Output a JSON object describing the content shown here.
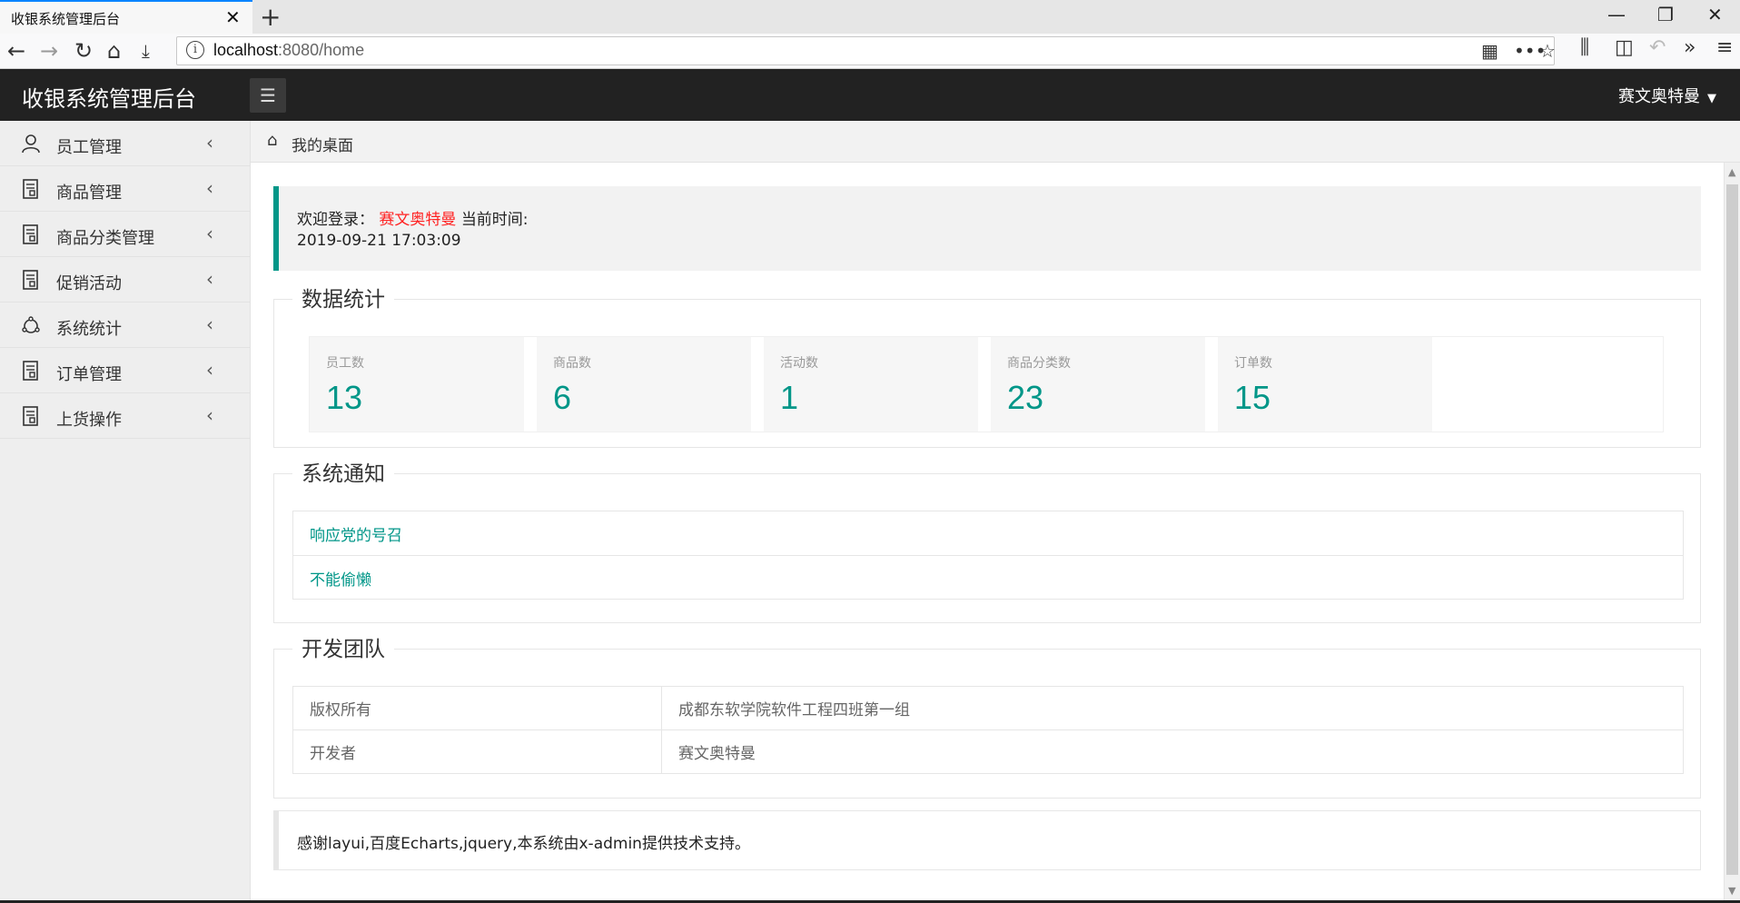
{
  "browser": {
    "tab_title": "收银系统管理后台",
    "tab_close": "✕",
    "new_tab": "+",
    "url_host": "localhost",
    "url_rest": ":8080/home",
    "win_min": "—",
    "win_restore": "❐",
    "win_close": "✕"
  },
  "header": {
    "logo": "收银系统管理后台",
    "menu_icon": "list-icon",
    "user_name": "赛文奥特曼",
    "user_caret": "▼"
  },
  "sidebar": {
    "items": [
      {
        "label": "员工管理",
        "icon": "user-icon"
      },
      {
        "label": "商品管理",
        "icon": "document-icon"
      },
      {
        "label": "商品分类管理",
        "icon": "document-icon"
      },
      {
        "label": "促销活动",
        "icon": "document-icon"
      },
      {
        "label": "系统统计",
        "icon": "chart-icon"
      },
      {
        "label": "订单管理",
        "icon": "document-icon"
      },
      {
        "label": "上货操作",
        "icon": "document-icon"
      }
    ],
    "chevron": "‹"
  },
  "breadcrumb": {
    "label": "我的桌面"
  },
  "welcome": {
    "prefix": "欢迎登录：",
    "user": "赛文奥特曼",
    "time_label": "当前时间:",
    "time_value": "2019-09-21 17:03:09"
  },
  "stats": {
    "title": "数据统计",
    "cards": [
      {
        "label": "员工数",
        "value": "13"
      },
      {
        "label": "商品数",
        "value": "6"
      },
      {
        "label": "活动数",
        "value": "1"
      },
      {
        "label": "商品分类数",
        "value": "23"
      },
      {
        "label": "订单数",
        "value": "15"
      }
    ]
  },
  "notices": {
    "title": "系统通知",
    "items": [
      "响应党的号召",
      "不能偷懒"
    ]
  },
  "team": {
    "title": "开发团队",
    "rows": [
      {
        "key": "版权所有",
        "value": "成都东软学院软件工程四班第一组"
      },
      {
        "key": "开发者",
        "value": "赛文奥特曼"
      }
    ]
  },
  "footer": {
    "thanks": "感谢layui,百度Echarts,jquery,本系统由x-admin提供技术支持。"
  },
  "colors": {
    "accent": "#009688",
    "header_bg": "#222222",
    "highlight_user": "#ff2222"
  }
}
